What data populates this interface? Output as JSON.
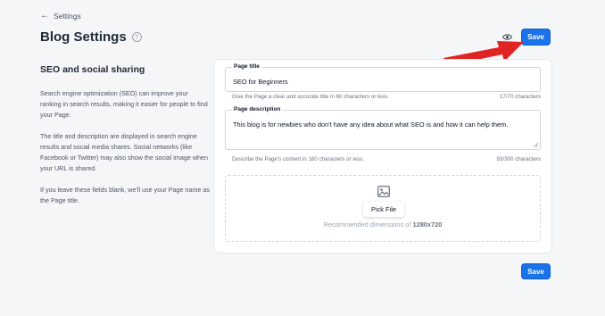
{
  "header": {
    "back_label": "Settings",
    "title": "Blog Settings",
    "help_glyph": "?",
    "save_label": "Save"
  },
  "sidebar": {
    "heading": "SEO and social sharing",
    "paragraphs": [
      "Search engine optimization (SEO) can improve your ranking in search results, making it easier for people to find your Page.",
      "The title and description are displayed in search engine results and social media shares. Social networks (like Facebook or Twitter) may also show the social image when your URL is shared.",
      "If you leave these fields blank, we'll use your Page name as the Page title."
    ]
  },
  "form": {
    "title_field": {
      "label": "Page title",
      "value": "SEO for Beginners",
      "hint": "Give the Page a clear and accurate title in 60 characters or less.",
      "count": "17/70 characters"
    },
    "description_field": {
      "label": "Page description",
      "value": "This blog is for newbies who don't have any idea about what SEO is and how it can help them.",
      "hint": "Describe the Page's content in 160 characters or less.",
      "count": "93/300 characters"
    },
    "image_upload": {
      "button_label": "Pick File",
      "recommended_prefix": "Recommended dimensions of",
      "recommended_dims": "1280x720"
    }
  },
  "footer": {
    "save_label": "Save"
  },
  "colors": {
    "accent": "#1a73e8",
    "annotation_arrow": "#e02424"
  },
  "icons": {
    "back": "arrow-left-icon",
    "help": "question-circle-icon",
    "preview": "eye-icon",
    "image": "image-icon",
    "annotation": "red-arrow-pointer"
  }
}
